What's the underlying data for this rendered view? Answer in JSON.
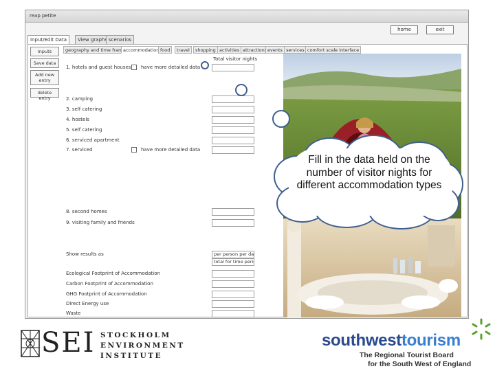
{
  "window": {
    "title": "reap petite",
    "home_label": "home",
    "exit_label": "exit"
  },
  "main_tabs": [
    "Input/Edit Data",
    "View graphs",
    "scenarios"
  ],
  "side_buttons": [
    "Inputs",
    "Save data",
    "Add new entry",
    "delete entry"
  ],
  "sub_tabs": [
    "geography and time frame",
    "accommodation",
    "food",
    "travel",
    "shopping",
    "activities",
    "attractions",
    "events",
    "services",
    "comfort scale interface"
  ],
  "form": {
    "total_header": "Total visitor nights",
    "rows": [
      {
        "label": "1. hotels and guest houses",
        "detail": "have more detailed data"
      },
      {
        "label": "2. camping"
      },
      {
        "label": "3. self catering"
      },
      {
        "label": "4. hostels"
      },
      {
        "label": "5. self catering"
      },
      {
        "label": "6. serviced apartment"
      },
      {
        "label": "7. serviced",
        "detail": "have more detailed data"
      },
      {
        "label": "8. second homes"
      },
      {
        "label": "9. visiting family and friends"
      }
    ],
    "show_results_label": "Show results as",
    "show_results_options": [
      "per person per day",
      "total for time period"
    ],
    "result_rows": [
      "Ecological Footprint of Accommodation",
      "Carbon Footprint of Accommodation",
      "GHG Footprint of Accommodation",
      "Direct Energy use",
      "Waste"
    ]
  },
  "callout": {
    "text": "Fill in the data held on the number of visitor nights for different accommodation types"
  },
  "logos": {
    "sei_mark": "SEI",
    "sei_line1": "STOCKHOLM",
    "sei_line2": "ENVIRONMENT",
    "sei_line3": "INSTITUTE",
    "swt_south": "southwest",
    "swt_tourism": "tourism",
    "swt_sub1": "The Regional Tourist Board",
    "swt_sub2": "for the South West of England"
  }
}
